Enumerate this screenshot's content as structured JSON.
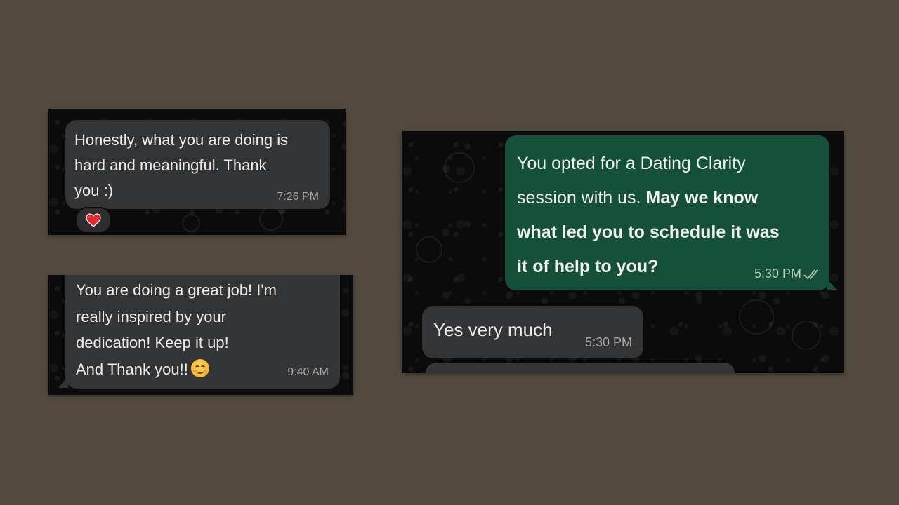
{
  "panels": [
    {
      "message": "Honestly, what you are doing is\nhard and meaningful. Thank\nyou :)",
      "time": "7:26 PM",
      "reaction": "heart-emoji"
    },
    {
      "message": "You are doing a great job! I'm\nreally inspired by your\ndedication! Keep it up!\nAnd Thank you!!",
      "emoji": "smiling-face-emoji",
      "time": "9:40 AM"
    },
    {
      "outgoing": {
        "text_regular": "You opted for a Dating Clarity\nsession with us. ",
        "text_bold": "May we know\nwhat led you to schedule it was\nit of help to you?",
        "time": "5:30 PM",
        "status": "read-double-check"
      },
      "incoming": {
        "message": "Yes very much",
        "time": "5:30 PM"
      }
    }
  ],
  "colors": {
    "background": "#524a3e",
    "chat_background": "#0b0b0b",
    "incoming_bubble": "#333436",
    "outgoing_bubble": "#15513a"
  }
}
